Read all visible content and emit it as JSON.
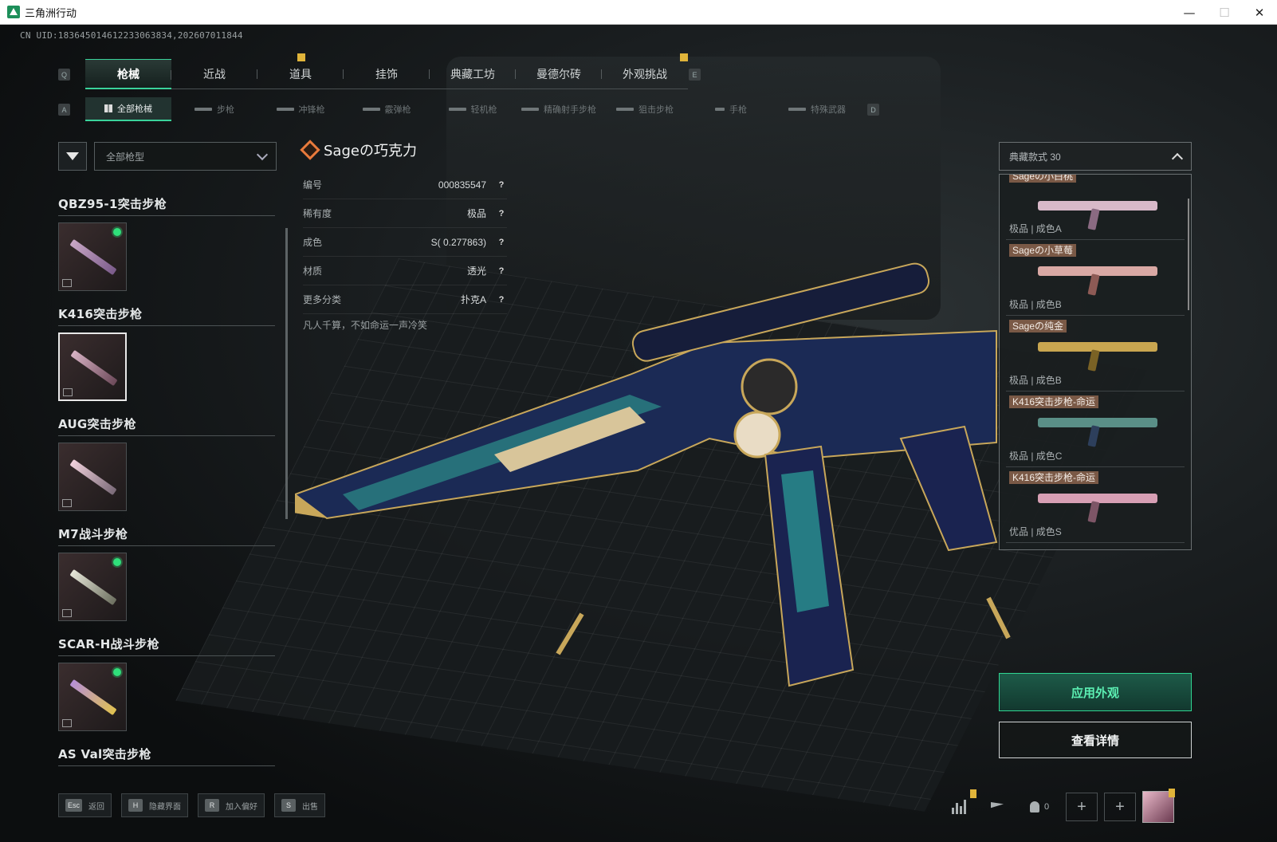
{
  "window": {
    "title": "三角洲行动",
    "min_label": "—",
    "max_label": "☐",
    "close_label": "✕"
  },
  "uid": "CN UID:18364501461223306383‌4,202607011844",
  "main_tabs": {
    "left_key": "Q",
    "right_key": "E",
    "items": [
      {
        "label": "枪械",
        "active": true
      },
      {
        "label": "近战"
      },
      {
        "label": "道具",
        "badge": true
      },
      {
        "label": "挂饰"
      },
      {
        "label": "典藏工坊"
      },
      {
        "label": "曼德尔砖"
      },
      {
        "label": "外观挑战",
        "badge": true
      }
    ]
  },
  "sub_tabs": {
    "left_key": "A",
    "right_key": "D",
    "items": [
      {
        "label": "全部枪械",
        "active": true
      },
      {
        "label": "步枪"
      },
      {
        "label": "冲锋枪"
      },
      {
        "label": "霰弹枪"
      },
      {
        "label": "轻机枪"
      },
      {
        "label": "精确射手步枪"
      },
      {
        "label": "狙击步枪"
      },
      {
        "label": "手枪"
      },
      {
        "label": "特殊武器"
      }
    ]
  },
  "filter": {
    "type_select": "全部枪型"
  },
  "weapon_list": [
    {
      "title": "QBZ95-1突击步枪",
      "equipped": true,
      "selected": false
    },
    {
      "title": "K416突击步枪",
      "equipped": false,
      "selected": true
    },
    {
      "title": "AUG突击步枪",
      "equipped": false,
      "selected": false
    },
    {
      "title": "M7战斗步枪",
      "equipped": true,
      "selected": false
    },
    {
      "title": "SCAR-H战斗步枪",
      "equipped": true,
      "selected": false
    },
    {
      "title": "AS Val突击步枪"
    }
  ],
  "skin": {
    "name": "Sageの巧克力",
    "rows": [
      {
        "key": "编号",
        "value": "000835547"
      },
      {
        "key": "稀有度",
        "value": "极品"
      },
      {
        "key": "成色",
        "value": "S( 0.277863)"
      },
      {
        "key": "材质",
        "value": "透光"
      },
      {
        "key": "更多分类",
        "value": "扑克A"
      }
    ],
    "help": "?",
    "quote": "凡人千算，不如命运一声冷笑"
  },
  "collection": {
    "select_label": "典藏款式 30",
    "items": [
      {
        "name": "Sageの小白桃",
        "meta": "极品 | 成色A",
        "color": "#d8b9c9",
        "accent": "#8a6a82"
      },
      {
        "name": "Sageの小草莓",
        "meta": "极品 | 成色B",
        "color": "#d9a8a4",
        "accent": "#8d5a55"
      },
      {
        "name": "Sageの纯金",
        "meta": "极品 | 成色B",
        "color": "#c9a650",
        "accent": "#7a6225"
      },
      {
        "name": "K416突击步枪-命运",
        "meta": "极品 | 成色C",
        "color": "#5a8f87",
        "accent": "#2d3f5c"
      },
      {
        "name": "K416突击步枪-命运",
        "meta": "优品 | 成色S",
        "color": "#d79fb4",
        "accent": "#7d5566"
      }
    ]
  },
  "actions": {
    "apply": "应用外观",
    "details": "查看详情"
  },
  "footer": [
    {
      "key": "Esc",
      "label": "返回"
    },
    {
      "key": "H",
      "label": "隐藏界面"
    },
    {
      "key": "R",
      "label": "加入偏好"
    },
    {
      "key": "S",
      "label": "出售"
    }
  ],
  "friends_count": "0",
  "colors": {
    "accent": "#3ad39b",
    "rarity": "#e87a3c",
    "badge": "#e0b43a"
  }
}
